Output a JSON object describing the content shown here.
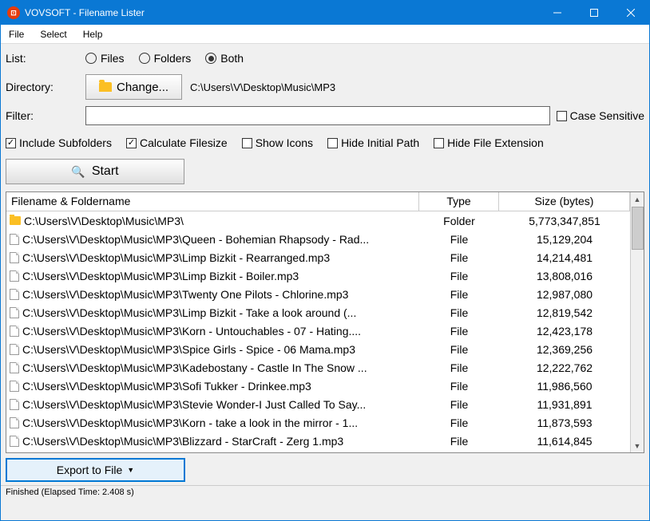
{
  "titlebar": {
    "icon_text": "⊡",
    "title": "VOVSOFT - Filename Lister"
  },
  "menu": {
    "file": "File",
    "select": "Select",
    "help": "Help"
  },
  "list": {
    "label": "List:",
    "files": "Files",
    "folders": "Folders",
    "both": "Both",
    "selected": "both"
  },
  "directory": {
    "label": "Directory:",
    "change_button": "Change...",
    "path": "C:\\Users\\V\\Desktop\\Music\\MP3"
  },
  "filter": {
    "label": "Filter:",
    "value": "",
    "case_sensitive": "Case Sensitive"
  },
  "options": {
    "include_subfolders": "Include Subfolders",
    "calculate_filesize": "Calculate Filesize",
    "show_icons": "Show Icons",
    "hide_initial_path": "Hide Initial Path",
    "hide_file_extension": "Hide File Extension"
  },
  "start_button": "Start",
  "table": {
    "headers": {
      "name": "Filename & Foldername",
      "type": "Type",
      "size": "Size (bytes)"
    },
    "rows": [
      {
        "icon": "folder",
        "name": "C:\\Users\\V\\Desktop\\Music\\MP3\\",
        "type": "Folder",
        "size": "5,773,347,851"
      },
      {
        "icon": "file",
        "name": "C:\\Users\\V\\Desktop\\Music\\MP3\\Queen - Bohemian Rhapsody - Rad...",
        "type": "File",
        "size": "15,129,204"
      },
      {
        "icon": "file",
        "name": "C:\\Users\\V\\Desktop\\Music\\MP3\\Limp Bizkit - Rearranged.mp3",
        "type": "File",
        "size": "14,214,481"
      },
      {
        "icon": "file",
        "name": "C:\\Users\\V\\Desktop\\Music\\MP3\\Limp Bizkit - Boiler.mp3",
        "type": "File",
        "size": "13,808,016"
      },
      {
        "icon": "file",
        "name": "C:\\Users\\V\\Desktop\\Music\\MP3\\Twenty One Pilots - Chlorine.mp3",
        "type": "File",
        "size": "12,987,080"
      },
      {
        "icon": "file",
        "name": "C:\\Users\\V\\Desktop\\Music\\MP3\\Limp Bizkit - Take a look around (...",
        "type": "File",
        "size": "12,819,542"
      },
      {
        "icon": "file",
        "name": "C:\\Users\\V\\Desktop\\Music\\MP3\\Korn - Untouchables - 07 - Hating....",
        "type": "File",
        "size": "12,423,178"
      },
      {
        "icon": "file",
        "name": "C:\\Users\\V\\Desktop\\Music\\MP3\\Spice Girls - Spice - 06 Mama.mp3",
        "type": "File",
        "size": "12,369,256"
      },
      {
        "icon": "file",
        "name": "C:\\Users\\V\\Desktop\\Music\\MP3\\Kadebostany - Castle In The Snow ...",
        "type": "File",
        "size": "12,222,762"
      },
      {
        "icon": "file",
        "name": "C:\\Users\\V\\Desktop\\Music\\MP3\\Sofi Tukker - Drinkee.mp3",
        "type": "File",
        "size": "11,986,560"
      },
      {
        "icon": "file",
        "name": "C:\\Users\\V\\Desktop\\Music\\MP3\\Stevie Wonder-I Just Called To Say...",
        "type": "File",
        "size": "11,931,891"
      },
      {
        "icon": "file",
        "name": "C:\\Users\\V\\Desktop\\Music\\MP3\\Korn - take a look in the mirror - 1...",
        "type": "File",
        "size": "11,873,593"
      },
      {
        "icon": "file",
        "name": "C:\\Users\\V\\Desktop\\Music\\MP3\\Blizzard - StarCraft - Zerg 1.mp3",
        "type": "File",
        "size": "11,614,845"
      }
    ]
  },
  "export_button": "Export to File",
  "status": "Finished (Elapsed Time: 2.408 s)"
}
